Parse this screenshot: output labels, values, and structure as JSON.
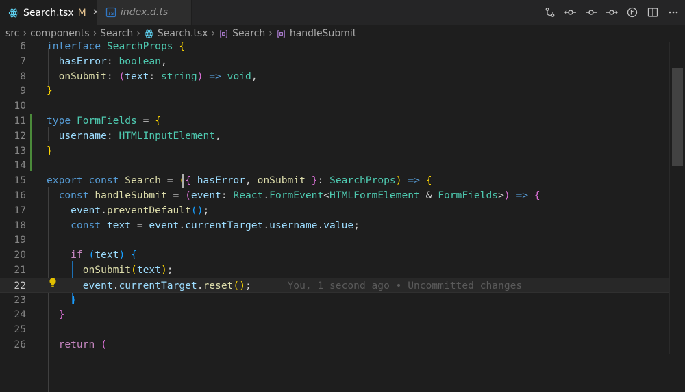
{
  "tabs": [
    {
      "label": "Search.tsx",
      "modified": "M",
      "close": "✕",
      "icon": "react-icon"
    },
    {
      "label": "index.d.ts",
      "icon": "typescript-icon"
    }
  ],
  "breadcrumb": [
    {
      "label": "src"
    },
    {
      "label": "components"
    },
    {
      "label": "Search"
    },
    {
      "label": "Search.tsx",
      "icon": "react-icon"
    },
    {
      "label": "Search",
      "icon": "symbol-icon"
    },
    {
      "label": "handleSubmit",
      "icon": "symbol-icon"
    }
  ],
  "editor": {
    "current_line": "22",
    "blame": "You, 1 second ago • Uncommitted changes",
    "lines": [
      {
        "num": "6",
        "tokens": [
          [
            "k",
            "interface"
          ],
          [
            "p",
            " "
          ],
          [
            "t",
            "SearchProps"
          ],
          [
            "p",
            " "
          ],
          [
            "b1",
            "{"
          ]
        ]
      },
      {
        "num": "7",
        "tokens": [
          [
            "p",
            "  "
          ],
          [
            "v",
            "hasError"
          ],
          [
            "p",
            ": "
          ],
          [
            "t",
            "boolean"
          ],
          [
            "p",
            ","
          ]
        ]
      },
      {
        "num": "8",
        "tokens": [
          [
            "p",
            "  "
          ],
          [
            "f",
            "onSubmit"
          ],
          [
            "p",
            ": "
          ],
          [
            "b2",
            "("
          ],
          [
            "v",
            "text"
          ],
          [
            "p",
            ": "
          ],
          [
            "t",
            "string"
          ],
          [
            "b2",
            ")"
          ],
          [
            "p",
            " "
          ],
          [
            "k",
            "=>"
          ],
          [
            "p",
            " "
          ],
          [
            "t",
            "void"
          ],
          [
            "p",
            ","
          ]
        ]
      },
      {
        "num": "9",
        "tokens": [
          [
            "b1",
            "}"
          ]
        ]
      },
      {
        "num": "10",
        "tokens": []
      },
      {
        "num": "11",
        "tokens": [
          [
            "k",
            "type"
          ],
          [
            "p",
            " "
          ],
          [
            "t",
            "FormFields"
          ],
          [
            "p",
            " = "
          ],
          [
            "b1",
            "{"
          ]
        ]
      },
      {
        "num": "12",
        "tokens": [
          [
            "p",
            "  "
          ],
          [
            "v",
            "username"
          ],
          [
            "p",
            ": "
          ],
          [
            "t",
            "HTMLInputElement"
          ],
          [
            "p",
            ","
          ]
        ]
      },
      {
        "num": "13",
        "tokens": [
          [
            "b1",
            "}"
          ]
        ]
      },
      {
        "num": "14",
        "tokens": []
      },
      {
        "num": "15",
        "tokens": [
          [
            "k",
            "export"
          ],
          [
            "p",
            " "
          ],
          [
            "k",
            "const"
          ],
          [
            "p",
            " "
          ],
          [
            "f",
            "Search"
          ],
          [
            "p",
            " = "
          ],
          [
            "b1",
            "("
          ],
          [
            "b2",
            "{"
          ],
          [
            "p",
            " "
          ],
          [
            "v",
            "hasError"
          ],
          [
            "p",
            ", "
          ],
          [
            "f",
            "onSubmit"
          ],
          [
            "p",
            " "
          ],
          [
            "b2",
            "}"
          ],
          [
            "p",
            ": "
          ],
          [
            "t",
            "SearchProps"
          ],
          [
            "b1",
            ")"
          ],
          [
            "p",
            " "
          ],
          [
            "k",
            "=>"
          ],
          [
            "p",
            " "
          ],
          [
            "b1",
            "{"
          ]
        ]
      },
      {
        "num": "16",
        "tokens": [
          [
            "p",
            "  "
          ],
          [
            "k",
            "const"
          ],
          [
            "p",
            " "
          ],
          [
            "f",
            "handleSubmit"
          ],
          [
            "p",
            " = "
          ],
          [
            "b2",
            "("
          ],
          [
            "v",
            "event"
          ],
          [
            "p",
            ": "
          ],
          [
            "t",
            "React"
          ],
          [
            "p",
            "."
          ],
          [
            "t",
            "FormEvent"
          ],
          [
            "p",
            "<"
          ],
          [
            "t",
            "HTMLFormElement"
          ],
          [
            "p",
            " & "
          ],
          [
            "t",
            "FormFields"
          ],
          [
            "p",
            ">"
          ],
          [
            "b2",
            ")"
          ],
          [
            "p",
            " "
          ],
          [
            "k",
            "=>"
          ],
          [
            "p",
            " "
          ],
          [
            "b2",
            "{"
          ]
        ]
      },
      {
        "num": "17",
        "tokens": [
          [
            "p",
            "    "
          ],
          [
            "v",
            "event"
          ],
          [
            "p",
            "."
          ],
          [
            "f",
            "preventDefault"
          ],
          [
            "b3",
            "()"
          ],
          [
            "p",
            ";"
          ]
        ]
      },
      {
        "num": "18",
        "tokens": [
          [
            "p",
            "    "
          ],
          [
            "k",
            "const"
          ],
          [
            "p",
            " "
          ],
          [
            "v",
            "text"
          ],
          [
            "p",
            " = "
          ],
          [
            "v",
            "event"
          ],
          [
            "p",
            "."
          ],
          [
            "v",
            "currentTarget"
          ],
          [
            "p",
            "."
          ],
          [
            "v",
            "username"
          ],
          [
            "p",
            "."
          ],
          [
            "v",
            "value"
          ],
          [
            "p",
            ";"
          ]
        ]
      },
      {
        "num": "19",
        "tokens": []
      },
      {
        "num": "20",
        "tokens": [
          [
            "p",
            "    "
          ],
          [
            "r",
            "if"
          ],
          [
            "p",
            " "
          ],
          [
            "b3",
            "("
          ],
          [
            "v",
            "text"
          ],
          [
            "b3",
            ")"
          ],
          [
            "p",
            " "
          ],
          [
            "b3",
            "{"
          ]
        ]
      },
      {
        "num": "21",
        "tokens": [
          [
            "p",
            "      "
          ],
          [
            "f",
            "onSubmit"
          ],
          [
            "b1",
            "("
          ],
          [
            "v",
            "text"
          ],
          [
            "b1",
            ")"
          ],
          [
            "p",
            ";"
          ]
        ]
      },
      {
        "num": "22",
        "tokens": [
          [
            "p",
            "      "
          ],
          [
            "v",
            "event"
          ],
          [
            "p",
            "."
          ],
          [
            "v",
            "currentTarget"
          ],
          [
            "p",
            "."
          ],
          [
            "f",
            "reset"
          ],
          [
            "b1",
            "()"
          ],
          [
            "p",
            ";"
          ]
        ]
      },
      {
        "num": "23",
        "tokens": [
          [
            "p",
            "    "
          ],
          [
            "b3",
            "}"
          ]
        ]
      },
      {
        "num": "24",
        "tokens": [
          [
            "p",
            "  "
          ],
          [
            "b2",
            "}"
          ]
        ]
      },
      {
        "num": "25",
        "tokens": []
      },
      {
        "num": "26",
        "tokens": [
          [
            "p",
            "  "
          ],
          [
            "r",
            "return"
          ],
          [
            "p",
            " "
          ],
          [
            "b2",
            "("
          ]
        ]
      }
    ]
  }
}
